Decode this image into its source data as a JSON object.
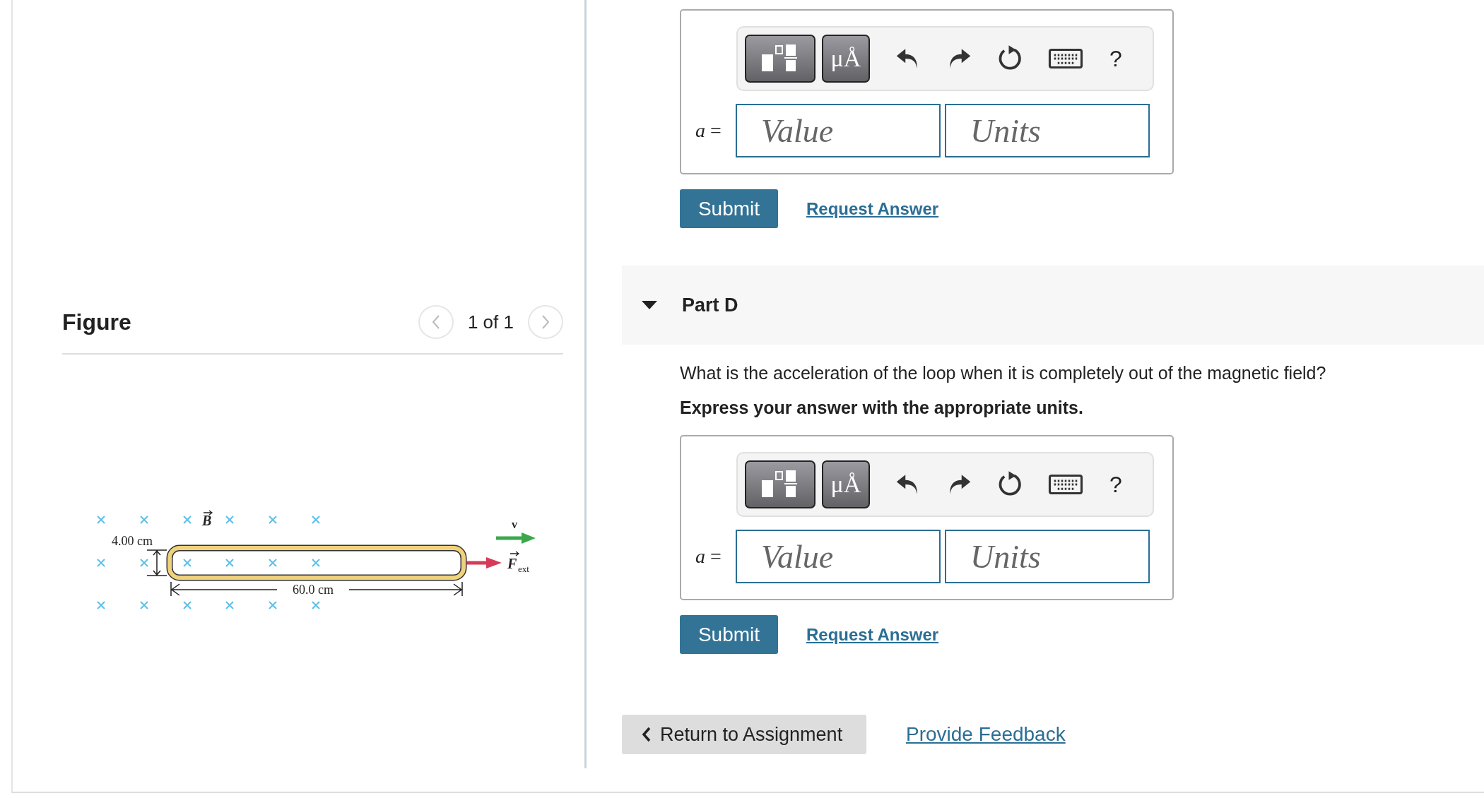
{
  "figure_panel": {
    "title": "Figure",
    "pager": "1 of 1",
    "drawing": {
      "field_label": "B",
      "width_label": "4.00 cm",
      "length_label": "60.0 cm",
      "velocity_label": "v",
      "force_label": "F",
      "force_subscript": "ext"
    }
  },
  "previous_answer": {
    "label": "*a* =",
    "toolbar": {
      "symbols": "μÅ",
      "help": "?"
    },
    "value_placeholder": "Value",
    "units_placeholder": "Units",
    "submit": "Submit",
    "request_answer": "Request Answer"
  },
  "part_d": {
    "title": "Part D",
    "expanded": true,
    "question": "What is the acceleration of the loop when it is completely out of the magnetic field?",
    "instruction": "Express your answer with the appropriate units.",
    "answer": {
      "label": "*a* =",
      "toolbar": {
        "symbols": "μÅ",
        "help": "?"
      },
      "value_placeholder": "Value",
      "units_placeholder": "Units",
      "submit": "Submit",
      "request_answer": "Request Answer"
    }
  },
  "footer": {
    "return_button": "Return to Assignment",
    "feedback_link": "Provide Feedback"
  }
}
